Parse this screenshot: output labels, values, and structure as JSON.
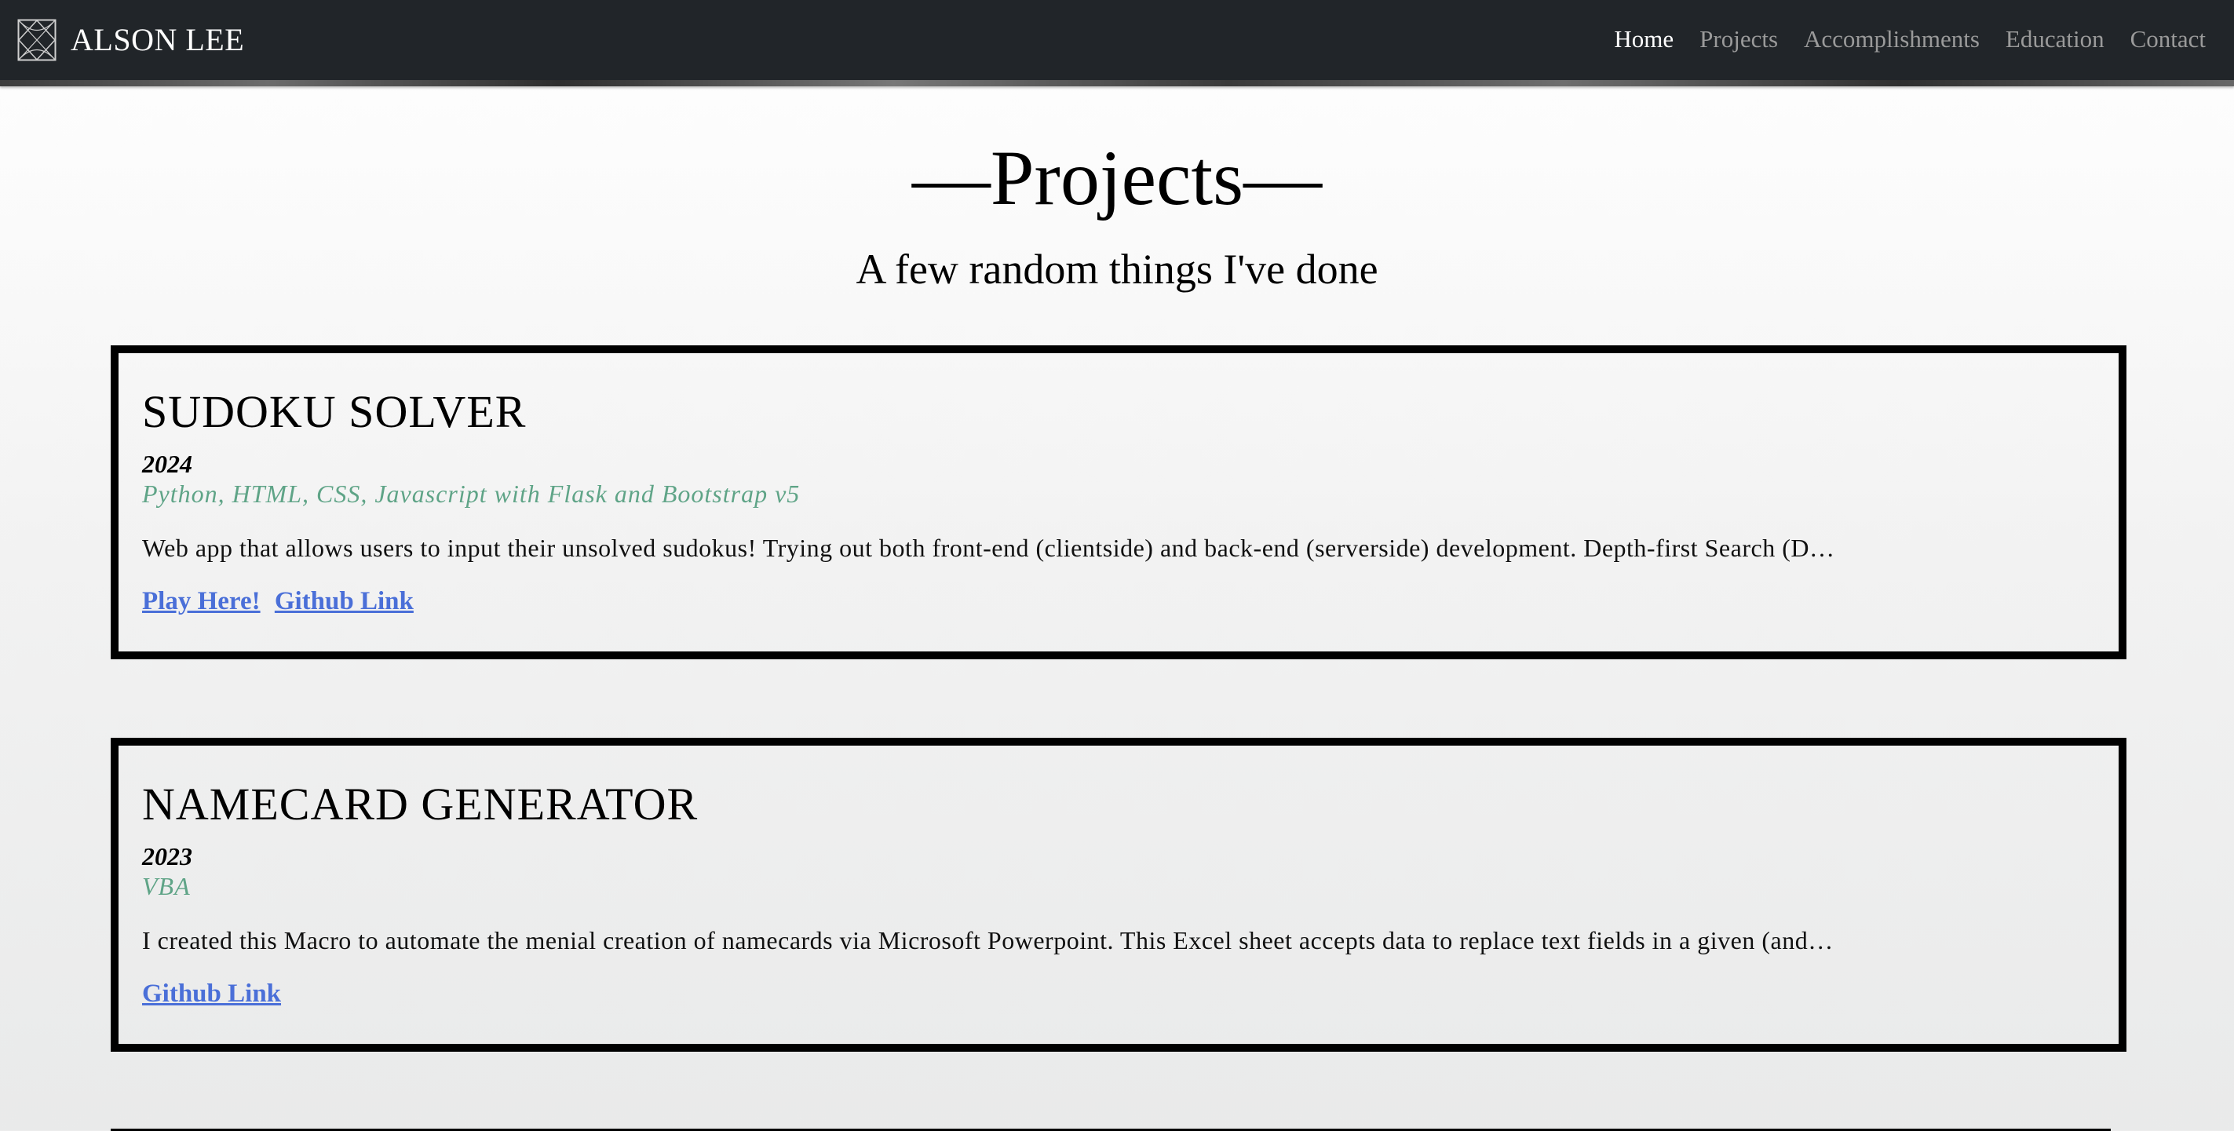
{
  "navbar": {
    "brand_name": "ALSON LEE",
    "logo_icon": "geometric-diamond-logo",
    "links": [
      {
        "label": "Home",
        "active": true
      },
      {
        "label": "Projects",
        "active": false
      },
      {
        "label": "Accomplishments",
        "active": false
      },
      {
        "label": "Education",
        "active": false
      },
      {
        "label": "Contact",
        "active": false
      }
    ]
  },
  "header": {
    "title": "—Projects—",
    "subtitle": "A few random things I've done"
  },
  "projects": [
    {
      "title": "SUDOKU SOLVER",
      "year": "2024",
      "tech": "Python, HTML, CSS, Javascript with Flask and Bootstrap v5",
      "description": "Web app that allows users to input their unsolved sudokus! Trying out both front-end (clientside) and back-end (serverside) development. Depth-first Search (D…",
      "links": [
        "Play Here!",
        "Github Link"
      ]
    },
    {
      "title": "NAMECARD GENERATOR",
      "year": "2023",
      "tech": "VBA",
      "description": "I created this Macro to automate the menial creation of namecards via Microsoft Powerpoint. This Excel sheet accepts data to replace text fields in a given (and…",
      "links": [
        "Github Link"
      ]
    }
  ],
  "colors": {
    "navbar_bg": "#212529",
    "tech_text": "#5fa487",
    "link": "#4a6fd8"
  }
}
